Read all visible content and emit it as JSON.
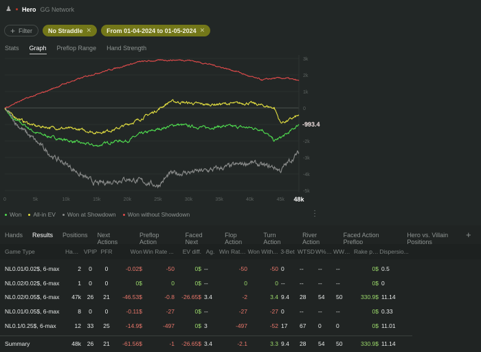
{
  "header": {
    "player": "Hero",
    "network": "GG Network"
  },
  "filters": {
    "add_label": "Filter",
    "chips": [
      {
        "label": "No Straddle"
      },
      {
        "label": "From 01-04-2024 to 01-05-2024"
      }
    ]
  },
  "view_tabs": [
    {
      "label": "Stats"
    },
    {
      "label": "Graph"
    },
    {
      "label": "Preflop Range"
    },
    {
      "label": "Hand Strength"
    }
  ],
  "chart_data": {
    "type": "line",
    "xlabel": "Hands",
    "ylabel": "",
    "xlim": [
      0,
      48000
    ],
    "ylim": [
      -5000,
      3000
    ],
    "x_ticks": [
      "0",
      "5k",
      "10k",
      "15k",
      "20k",
      "25k",
      "30k",
      "35k",
      "40k",
      "45k",
      "48k"
    ],
    "y_ticks": [
      "3k",
      "2k",
      "1k",
      "0",
      "-1k",
      "-2k",
      "-3k",
      "-4k",
      "-5k"
    ],
    "end_label": "-993.4",
    "legend_position": "bottom-left",
    "series": [
      {
        "name": "Won",
        "color": "#4fdc4f",
        "x": [
          0,
          1000,
          3000,
          5000,
          8000,
          12000,
          15000,
          18000,
          20000,
          22000,
          25000,
          28000,
          30000,
          33000,
          36000,
          40000,
          42000,
          44000,
          45000,
          46000,
          48000
        ],
        "values": [
          0,
          -600,
          -1000,
          -1500,
          -1800,
          -2100,
          -2300,
          -2000,
          -2000,
          -1600,
          -1300,
          -1000,
          -1100,
          -1200,
          -1100,
          -1200,
          -1300,
          -2000,
          -1800,
          -1600,
          -993.4
        ]
      },
      {
        "name": "All-in EV",
        "color": "#e4e040",
        "x": [
          0,
          1000,
          3000,
          5000,
          8000,
          12000,
          15000,
          18000,
          20000,
          22000,
          25000,
          27000,
          30000,
          33000,
          36000,
          40000,
          44000,
          45000,
          46000,
          48000
        ],
        "values": [
          0,
          -400,
          -800,
          -1100,
          -1200,
          -1300,
          -1500,
          -1300,
          -1000,
          -700,
          -100,
          400,
          300,
          200,
          250,
          300,
          0,
          -900,
          -800,
          -450
        ]
      },
      {
        "name": "Won at Showdown",
        "color": "#8a8c8b",
        "x": [
          0,
          2000,
          5000,
          8000,
          10000,
          13000,
          15000,
          18000,
          20000,
          23000,
          25000,
          27000,
          30000,
          33000,
          36000,
          40000,
          42000,
          44000,
          45000,
          46000,
          48000
        ],
        "values": [
          0,
          -1000,
          -2000,
          -3000,
          -3400,
          -4200,
          -4600,
          -4400,
          -4300,
          -4500,
          -4700,
          -4000,
          -3900,
          -3800,
          -3600,
          -3300,
          -3500,
          -3600,
          -3800,
          -3400,
          -2700
        ]
      },
      {
        "name": "Won without Showdown",
        "color": "#e04b4b",
        "x": [
          0,
          3000,
          6000,
          10000,
          14000,
          18000,
          22000,
          26000,
          30000,
          34000,
          38000,
          40000,
          42000,
          44000,
          46000,
          48000
        ],
        "values": [
          0,
          500,
          900,
          1500,
          2000,
          2400,
          2800,
          2900,
          2900,
          2600,
          2200,
          1900,
          1700,
          1800,
          1800,
          1650
        ]
      }
    ]
  },
  "results": {
    "tabs": [
      {
        "label": "Hands"
      },
      {
        "label": "Results"
      },
      {
        "label": "Positions"
      },
      {
        "label": "Next Actions"
      },
      {
        "label": "Preflop Action"
      },
      {
        "label": "Faced Next"
      },
      {
        "label": "Flop Action"
      },
      {
        "label": "Turn Action"
      },
      {
        "label": "River Action"
      },
      {
        "label": "Faced Action Preflop"
      },
      {
        "label": "Hero vs. Villain Positions"
      }
    ],
    "add_tab": "+",
    "columns": [
      "Game Type",
      "Hands",
      "VPIP",
      "PFR",
      "Won",
      "Win Rate ...",
      "EV diff.",
      "Ag.",
      "Win Rate, ...",
      "Won With...",
      "3-Bet",
      "WTSD",
      "W%SD",
      "WWSF%",
      "Rake paid",
      "Dispersio..."
    ],
    "rows": [
      [
        "NL0.01/0.02$, 6-max",
        "2",
        "0",
        "0",
        "-0.02$",
        "-50",
        "0$",
        "--",
        "-50",
        "-50",
        "0",
        "--",
        "--",
        "--",
        "0$",
        "0.5"
      ],
      [
        "NL0.02/0.02$, 6-max",
        "1",
        "0",
        "0",
        "0$",
        "0",
        "0$",
        "--",
        "0",
        "0",
        "--",
        "--",
        "--",
        "--",
        "0$",
        "0"
      ],
      [
        "NL0.02/0.05$, 6-max",
        "47k",
        "26",
        "21",
        "-46.53$",
        "-0.8",
        "-26.65$",
        "3.4",
        "-2",
        "3.4",
        "9.4",
        "28",
        "54",
        "50",
        "330.9$",
        "11.14"
      ],
      [
        "NL0.01/0.05$, 6-max",
        "8",
        "0",
        "0",
        "-0.11$",
        "-27",
        "0$",
        "--",
        "-27",
        "-27",
        "0",
        "--",
        "--",
        "--",
        "0$",
        "0.33"
      ],
      [
        "NL0.1/0.25$, 6-max",
        "12",
        "33",
        "25",
        "-14.9$",
        "-497",
        "0$",
        "3",
        "-497",
        "-52",
        "17",
        "67",
        "0",
        "0",
        "0$",
        "11.01"
      ]
    ],
    "summary": [
      "Summary",
      "48k",
      "26",
      "21",
      "-61.56$",
      "-1",
      "-26.65$",
      "3.4",
      "-2.1",
      "3.3",
      "9.4",
      "28",
      "54",
      "50",
      "330.9$",
      "11.14"
    ]
  }
}
